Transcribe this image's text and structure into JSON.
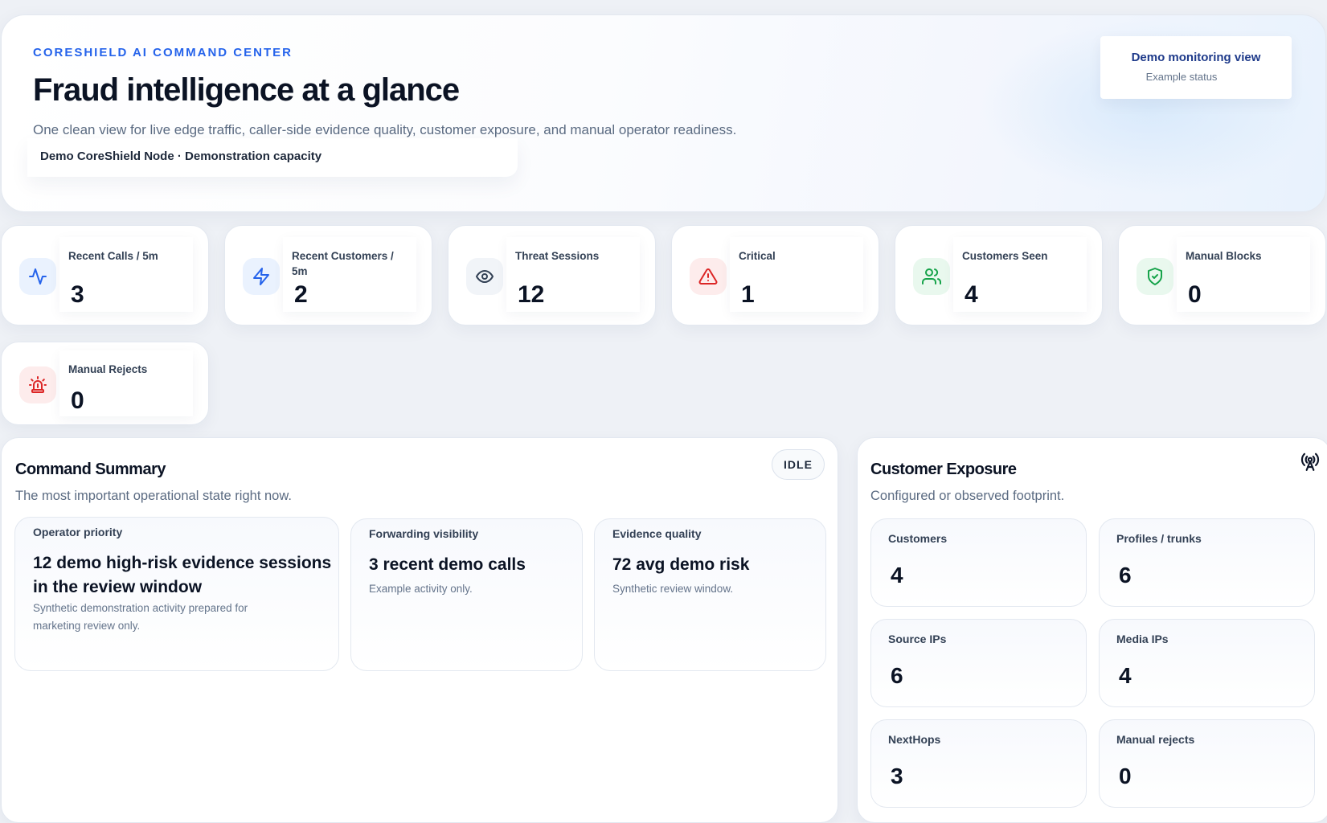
{
  "hero": {
    "eyebrow": "CORESHIELD AI COMMAND CENTER",
    "title": "Fraud intelligence at a glance",
    "subtitle": "One clean view for live edge traffic, caller-side evidence quality, customer exposure, and manual operator readiness.",
    "node_chip": "Demo CoreShield Node · Demonstration capacity",
    "status_title": "Demo monitoring view",
    "status_sub": "Example status"
  },
  "kpis": [
    {
      "label": "Recent Calls / 5m",
      "value": "3",
      "icon": "activity-icon",
      "color": "#2563eb"
    },
    {
      "label": "Recent Customers / 5m",
      "value": "2",
      "icon": "lightning-icon",
      "color": "#2563eb"
    },
    {
      "label": "Threat Sessions",
      "value": "12",
      "icon": "eye-icon",
      "color": "#334155"
    },
    {
      "label": "Critical",
      "value": "1",
      "icon": "warning-triangle-icon",
      "color": "#dc2626"
    },
    {
      "label": "Customers Seen",
      "value": "4",
      "icon": "users-icon",
      "color": "#16a34a"
    },
    {
      "label": "Manual Blocks",
      "value": "0",
      "icon": "shield-check-icon",
      "color": "#16a34a"
    },
    {
      "label": "Manual Rejects",
      "value": "0",
      "icon": "siren-icon",
      "color": "#dc2626"
    }
  ],
  "summary": {
    "title": "Command Summary",
    "subtitle": "The most important operational state right now.",
    "badge": "IDLE",
    "cards": [
      {
        "label": "Operator priority",
        "value": "12 demo high-risk evidence sessions in the review window",
        "note": "Synthetic demonstration activity prepared for marketing review only."
      },
      {
        "label": "Forwarding visibility",
        "value": "3 recent demo calls",
        "note": "Example activity only."
      },
      {
        "label": "Evidence quality",
        "value": "72 avg demo risk",
        "note": "Synthetic review window."
      }
    ]
  },
  "exposure": {
    "title": "Customer Exposure",
    "subtitle": "Configured or observed footprint.",
    "icon": "antenna-icon",
    "cards": [
      {
        "label": "Customers",
        "value": "4"
      },
      {
        "label": "Profiles / trunks",
        "value": "6"
      },
      {
        "label": "Source IPs",
        "value": "6"
      },
      {
        "label": "Media IPs",
        "value": "4"
      },
      {
        "label": "NextHops",
        "value": "3"
      },
      {
        "label": "Manual rejects",
        "value": "0"
      }
    ]
  }
}
